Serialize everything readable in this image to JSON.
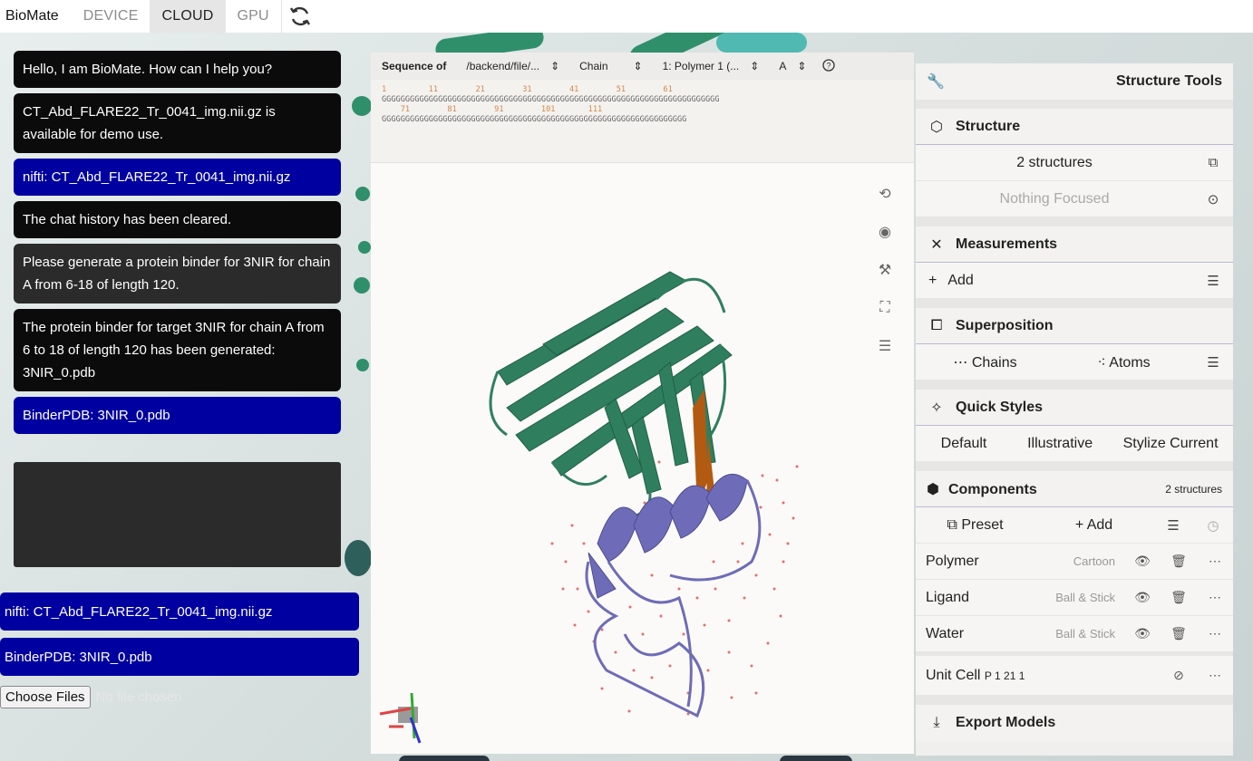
{
  "app": {
    "title": "BioMate"
  },
  "tabs": [
    {
      "label": "DEVICE",
      "active": false
    },
    {
      "label": "CLOUD",
      "active": true
    },
    {
      "label": "GPU",
      "active": false
    }
  ],
  "chat": {
    "messages": [
      {
        "style": "black",
        "text": "Hello, I am BioMate. How can I help you?"
      },
      {
        "style": "black",
        "text": "CT_Abd_FLARE22_Tr_0041_img.nii.gz is available for demo use."
      },
      {
        "style": "blue",
        "text": "nifti: CT_Abd_FLARE22_Tr_0041_img.nii.gz"
      },
      {
        "style": "black",
        "text": "The chat history has been cleared."
      },
      {
        "style": "gray",
        "text": "Please generate a protein binder for 3NIR for chain A from 6-18 of length 120."
      },
      {
        "style": "black",
        "text": "The protein binder for target 3NIR for chain A from 6 to 18 of length 120 has been generated: 3NIR_0.pdb"
      },
      {
        "style": "blue",
        "text": "BinderPDB: 3NIR_0.pdb"
      }
    ],
    "input_value": ""
  },
  "files": {
    "chips": [
      "nifti: CT_Abd_FLARE22_Tr_0041_img.nii.gz",
      "BinderPDB: 3NIR_0.pdb"
    ],
    "choose_label": "Choose Files",
    "no_file_label": "No file chosen"
  },
  "sequence": {
    "header": "Sequence of",
    "file": "/backend/file/...",
    "chain_label": "Chain",
    "polymer": "1: Polymer 1 (...",
    "chain_id": "A",
    "numbers_line1": "1         11        21        31        41        51        61",
    "seq_line1": "GGGGGGGGGGGGGGGGGGGGGGGGGGGGGGGGGGGGGGGGGGGGGGGGGGGGGGGGGGGGGGGGGGGGGGGG",
    "numbers_line2": "    71        81        91        101       111",
    "seq_line2": "GGGGGGGGGGGGGGGGGGGGGGGGGGGGGGGGGGGGGGGGGGGGGGGGGGGGGGGGGGGGGGGGG"
  },
  "panel": {
    "title": "Structure Tools",
    "structure": {
      "heading": "Structure",
      "count": "2 structures",
      "focus": "Nothing Focused"
    },
    "measurements": {
      "heading": "Measurements",
      "add": "Add"
    },
    "superposition": {
      "heading": "Superposition",
      "chains": "Chains",
      "atoms": "Atoms"
    },
    "quick_styles": {
      "heading": "Quick Styles",
      "default": "Default",
      "illustrative": "Illustrative",
      "stylize": "Stylize Current"
    },
    "components": {
      "heading": "Components",
      "count": "2 structures",
      "preset": "Preset",
      "add": "Add",
      "items": [
        {
          "name": "Polymer",
          "type": "Cartoon"
        },
        {
          "name": "Ligand",
          "type": "Ball & Stick"
        },
        {
          "name": "Water",
          "type": "Ball & Stick"
        }
      ],
      "unit_cell": "Unit Cell",
      "unit_cell_group": "P 1 21 1"
    },
    "export": {
      "heading": "Export Models"
    }
  },
  "colors": {
    "chain_green": "#2f7f5f",
    "chain_purple": "#6e6cb8",
    "ligand_orange": "#b35a12",
    "water_red": "#e07070",
    "chat_blue": "#0000a0"
  }
}
